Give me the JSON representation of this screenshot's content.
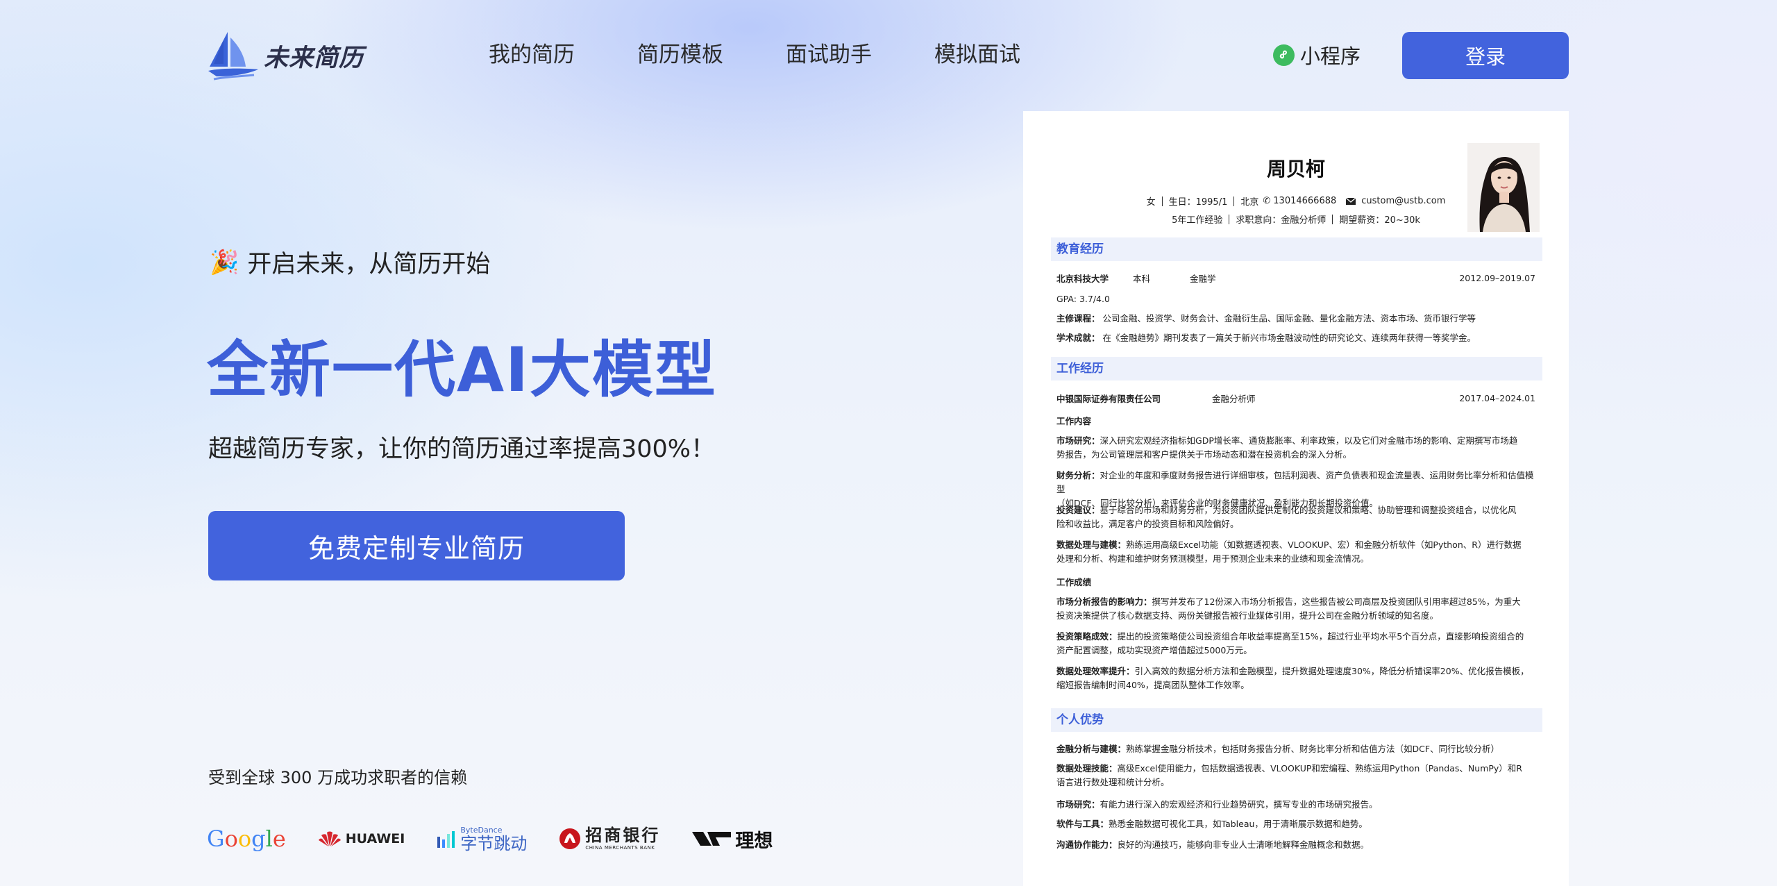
{
  "brand": {
    "name": "未来简历"
  },
  "nav": {
    "items": [
      "我的简历",
      "简历模板",
      "面试助手",
      "模拟面试"
    ],
    "mini_program": "小程序",
    "login": "登录"
  },
  "hero": {
    "tagline": "开启未来，从简历开始",
    "headline": "全新一代AI大模型",
    "subline": "超越简历专家，让你的简历通过率提高300%！",
    "cta": "免费定制专业简历",
    "trust": "受到全球 300 万成功求职者的信赖"
  },
  "brands": {
    "google": "Google",
    "huawei": "HUAWEI",
    "bytedance_en": "ByteDance",
    "bytedance_cn": "字节跳动",
    "cmb_cn": "招商银行",
    "cmb_en": "CHINA MERCHANTS BANK",
    "lixiang": "理想"
  },
  "resume": {
    "name": "周贝柯",
    "gender": "女",
    "birth": "生日：1995/1",
    "city": "北京",
    "phone": "13014666688",
    "email": "custom@ustb.com",
    "experience": "5年工作经验",
    "intent": "求职意向：金融分析师",
    "salary": "期望薪资：20~30k",
    "education": {
      "title": "教育经历",
      "school": "北京科技大学",
      "degree": "本科",
      "major": "金融学",
      "period": "2012.09–2019.07",
      "gpa_label": "GPA:",
      "gpa": "3.7/4.0",
      "courses_label": "主修课程：",
      "courses": "公司金融、投资学、财务会计、金融衍生品、国际金融、量化金融方法、资本市场、货币银行学等",
      "awards_label": "学术成就：",
      "awards": "在《金融趋势》期刊发表了一篇关于新兴市场金融波动性的研究论文、连续两年获得一等奖学金。"
    },
    "work": {
      "title": "工作经历",
      "company": "中银国际证券有限责任公司",
      "role": "金融分析师",
      "period": "2017.04–2024.01",
      "content_title": "工作内容",
      "items": [
        {
          "label": "市场研究：",
          "line1": "深入研究宏观经济指标如GDP增长率、通货膨胀率、利率政策，以及它们对金融市场的影响、定期撰写市场趋",
          "line2": "势报告，为公司管理层和客户提供关于市场动态和潜在投资机会的深入分析。"
        },
        {
          "label": "财务分析：",
          "line1": "对企业的年度和季度财务报告进行详细审核，包括利润表、资产负债表和现金流量表、运用财务比率分析和估值模型",
          "line2": "（如DCF、同行比较分析）来评估企业的财务健康状况、盈利能力和长期投资价值。"
        },
        {
          "label": "投资建议：",
          "line1": "基于综合的市场和财务分析，为投资团队提供定制化的投资建议和策略、协助管理和调整投资组合，以优化风",
          "line2": "险和收益比，满足客户的投资目标和风险偏好。"
        },
        {
          "label": "数据处理与建模：",
          "line1": "熟练运用高级Excel功能（如数据透视表、VLOOKUP、宏）和金融分析软件（如Python、R）进行数据",
          "line2": "处理和分析、构建和维护财务预测模型，用于预测企业未来的业绩和现金流情况。"
        }
      ],
      "results_title": "工作成绩",
      "results": [
        {
          "label": "市场分析报告的影响力：",
          "line1": "撰写并发布了12份深入市场分析报告，这些报告被公司高层及投资团队引用率超过85%，为重大",
          "line2": "投资决策提供了核心数据支持、两份关键报告被行业媒体引用，提升公司在金融分析领域的知名度。"
        },
        {
          "label": "投资策略成效：",
          "line1": "提出的投资策略使公司投资组合年收益率提高至15%，超过行业平均水平5个百分点，直接影响投资组合的",
          "line2": "资产配置调整，成功实现资产增值超过5000万元。"
        },
        {
          "label": "数据处理效率提升：",
          "line1": "引入高效的数据分析方法和金融模型，提升数据处理速度30%，降低分析错误率20%、优化报告模板，",
          "line2": "缩短报告编制时间40%，提高团队整体工作效率。"
        }
      ]
    },
    "strengths": {
      "title": "个人优势",
      "items": [
        {
          "label": "金融分析与建模：",
          "line1": "熟练掌握金融分析技术，包括财务报告分析、财务比率分析和估值方法（如DCF、同行比较分析）",
          "line2": ""
        },
        {
          "label": "数据处理技能：",
          "line1": "高级Excel使用能力，包括数据透视表、VLOOKUP和宏编程、熟练运用Python（Pandas、NumPy）和R",
          "line2": "语言进行数处理和统计分析。"
        },
        {
          "label": "市场研究：",
          "line1": "有能力进行深入的宏观经济和行业趋势研究，撰写专业的市场研究报告。",
          "line2": ""
        },
        {
          "label": "软件与工具：",
          "line1": "熟悉金融数据可视化工具，如Tableau，用于清晰展示数据和趋势。",
          "line2": ""
        },
        {
          "label": "沟通协作能力：",
          "line1": "良好的沟通技巧，能够向非专业人士清晰地解释金融概念和数据。",
          "line2": ""
        }
      ]
    }
  },
  "colors": {
    "primary": "#4263dd",
    "headline": "#3d5fd8",
    "section_bg": "#edf1fb",
    "mini_program_green": "#3dbb5f"
  }
}
